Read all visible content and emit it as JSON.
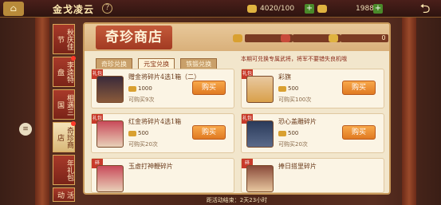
{
  "topbar": {
    "title": "金戈凌云",
    "gold": "4020/100",
    "jade": "1988"
  },
  "sidebar": {
    "tabs": [
      "秋庆佳节",
      "李逵特盘",
      "相遇三国",
      "奇珍商店",
      "年礼包",
      "活动"
    ]
  },
  "panel": {
    "title": "奇珍商店",
    "currencies": [
      "0",
      "0",
      "0"
    ],
    "tabs": [
      "奇珍兑换",
      "元宝兑换",
      "铁锻兑换"
    ],
    "notice": "本期可兑换专属武将，将军不要错失良机哦"
  },
  "cards": [
    {
      "badge": "礼包",
      "name": "赠金将碎片4选1箱（二）",
      "price": "1000",
      "limit": "可购买9次",
      "buy": "购买"
    },
    {
      "badge": "礼包",
      "name": "彩旗",
      "price": "500",
      "limit": "可购买100次",
      "buy": "购买"
    },
    {
      "badge": "礼包",
      "name": "红金将碎片4选1箱",
      "price": "500",
      "limit": "可购买20次",
      "buy": "购买"
    },
    {
      "badge": "礼包",
      "name": "恐心盖雕碎片",
      "price": "500",
      "limit": "可购买20次",
      "buy": "购买"
    },
    {
      "badge": "碎",
      "name": "玉虚打神鞭碎片"
    },
    {
      "badge": "碎",
      "name": "捧日搭里碎片"
    }
  ],
  "footer": {
    "countdown": "距活动结束：2天23小时"
  },
  "colors": {
    "panel": "#f2e6cc",
    "accent": "#c83a2a",
    "buy": "#e07a22"
  }
}
